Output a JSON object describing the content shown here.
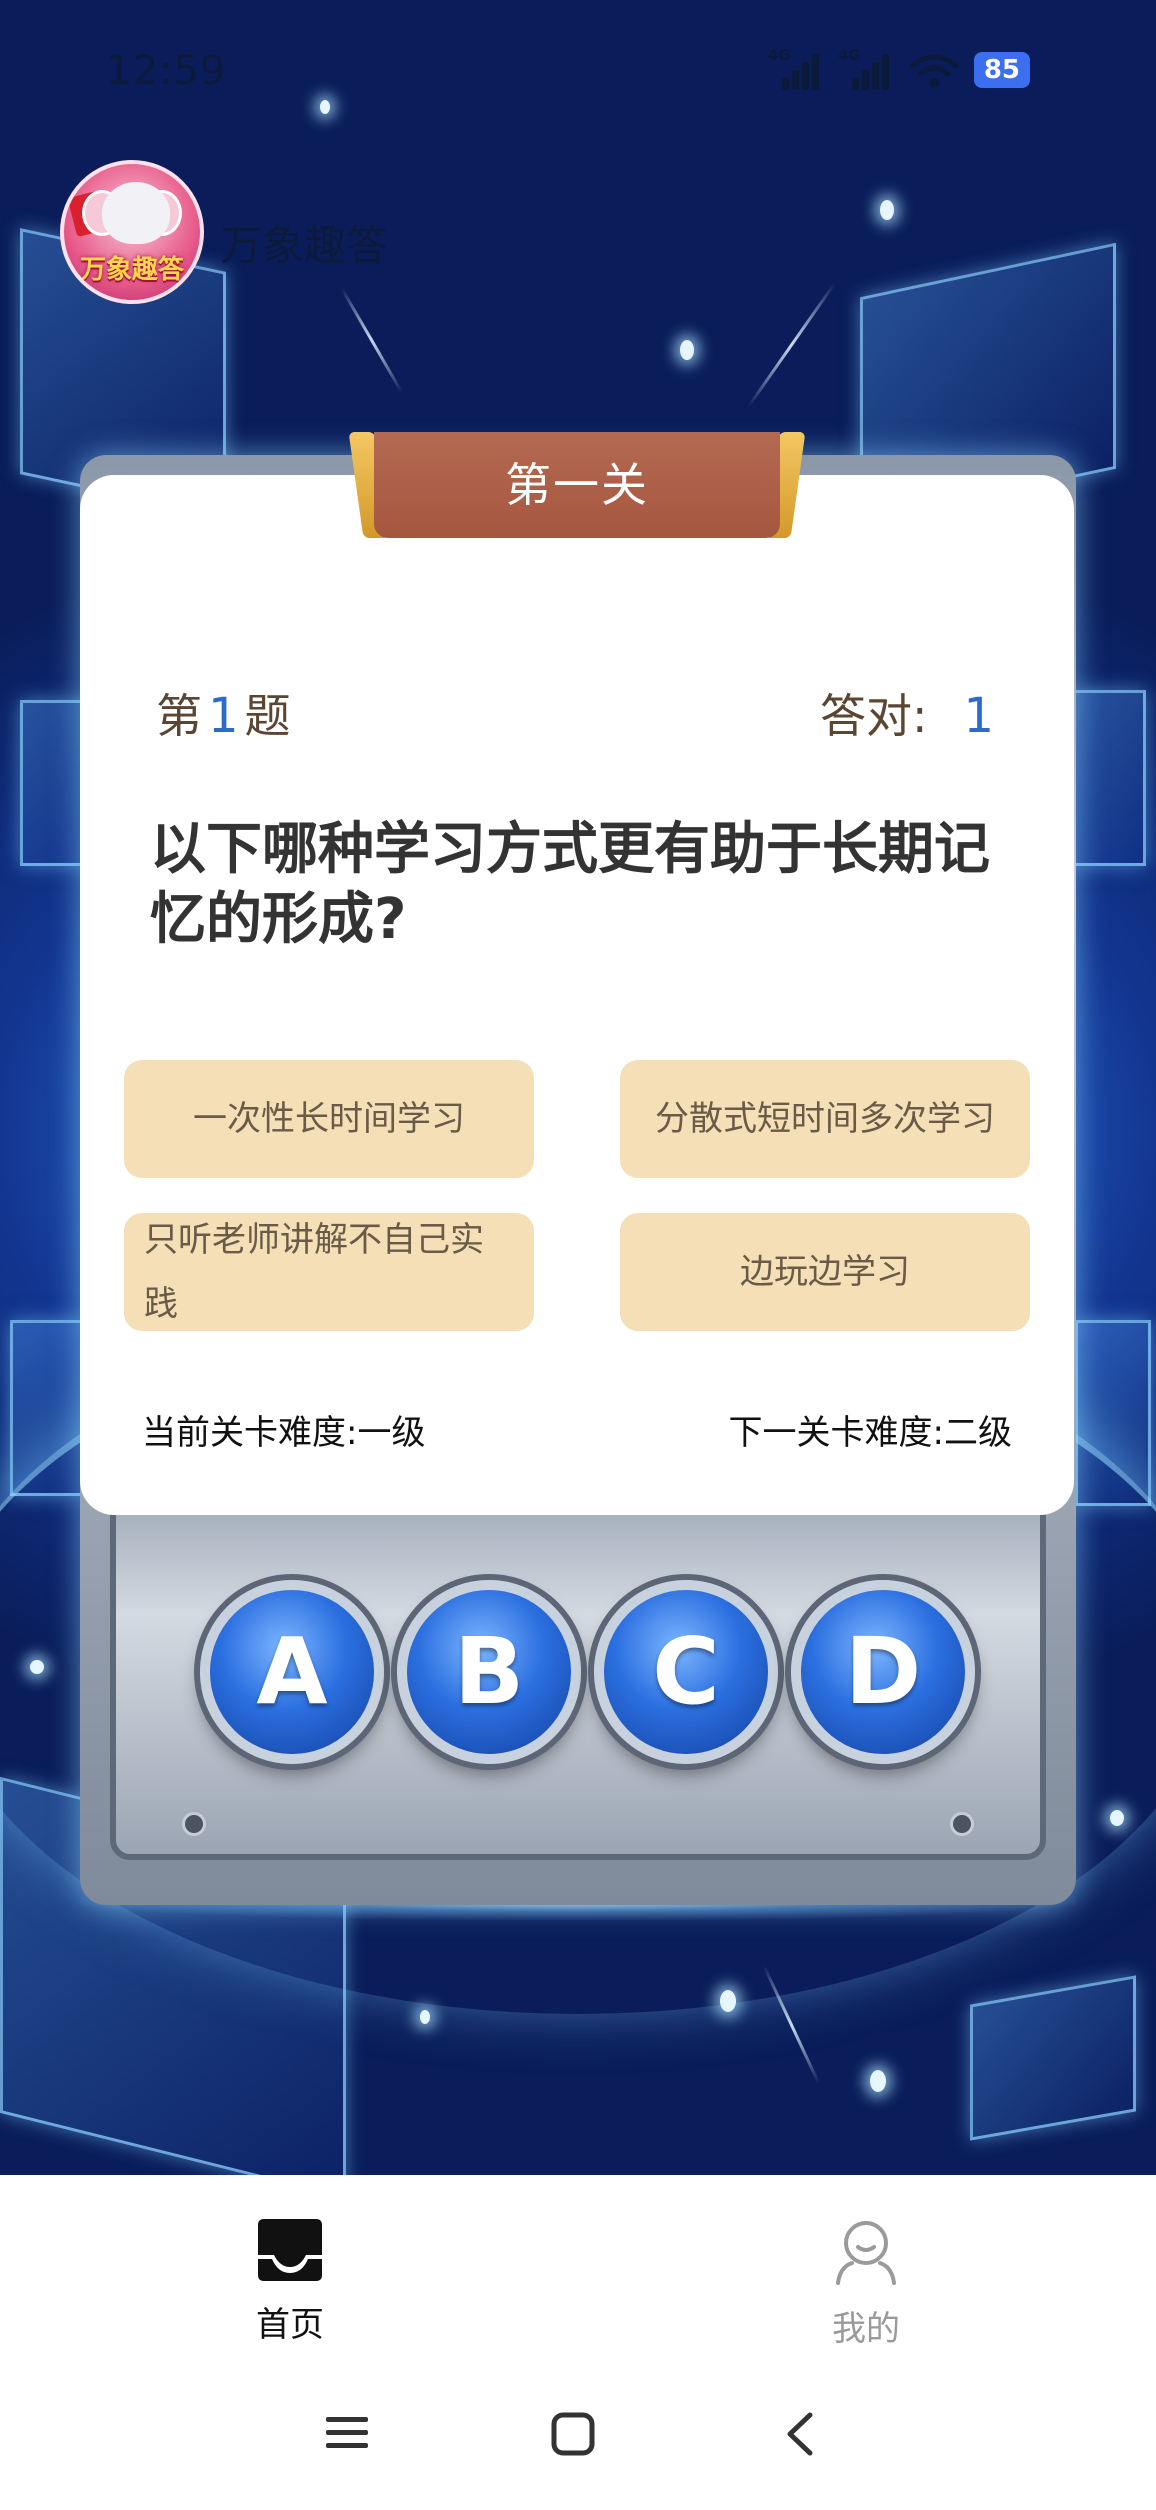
{
  "status_bar": {
    "time": "12:59",
    "signal_1_label": "4G",
    "signal_2_label": "4G",
    "battery": "85"
  },
  "header": {
    "logo_text": "万象趣答",
    "app_name": "万象趣答"
  },
  "level": {
    "title": "第一关"
  },
  "quiz": {
    "question_prefix": "第",
    "question_number": "1",
    "question_suffix": "题",
    "correct_label": "答对:",
    "correct_count": "1",
    "question_text": "以下哪种学习方式更有助于长期记忆的形成?",
    "options": [
      "一次性长时间学习",
      "分散式短时间多次学习",
      "只听老师讲解不自己实践",
      "边玩边学习"
    ],
    "current_difficulty": "当前关卡难度:一级",
    "next_difficulty": "下一关卡难度:二级"
  },
  "answer_buttons": [
    "A",
    "B",
    "C",
    "D"
  ],
  "tabbar": {
    "home_label": "首页",
    "mine_label": "我的"
  },
  "colors": {
    "accent_blue": "#2c6bc7",
    "option_bg": "#f5dfb6",
    "ribbon": "#a6563f",
    "battery": "#3b6ff0"
  },
  "icons": {
    "home_tab": "inbox-tray-icon",
    "mine_tab": "user-icon",
    "nav_menu": "menu-icon",
    "nav_home": "square-icon",
    "nav_back": "back-icon"
  }
}
